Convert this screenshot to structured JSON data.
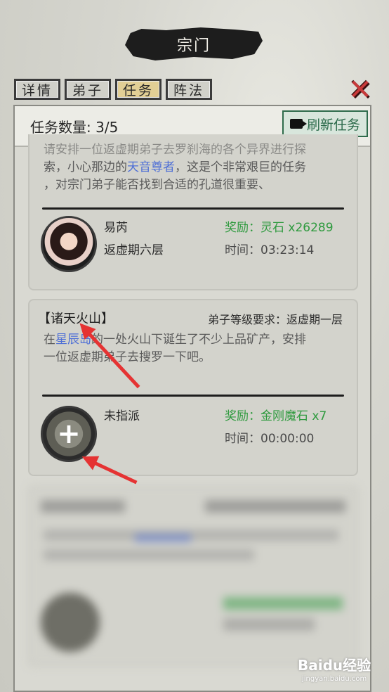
{
  "window": {
    "title": "宗门"
  },
  "tabs": [
    {
      "label": "详情"
    },
    {
      "label": "弟子"
    },
    {
      "label": "任务",
      "active": true
    },
    {
      "label": "阵法"
    }
  ],
  "close_icon": "close-x-icon",
  "header": {
    "task_count_label": "任务数量:",
    "task_count_value": "3/5",
    "refresh_label": "刷新任务",
    "refresh_icon": "video-camera-icon"
  },
  "task1": {
    "desc_line1": "请安排一位返虚期弟子去罗刹海的各个异界进行探",
    "desc_line2_pre": "索，小心那边的",
    "desc_line2_hl": "天音尊者",
    "desc_line2_post": "，这是个非常艰巨的任务",
    "desc_line3": "，对宗门弟子能否找到合适的孔道很重要、",
    "disciple_name": "易芮",
    "disciple_rank": "返虚期六层",
    "reward": "奖励：灵石 x26289",
    "time": "时间：03:23:14"
  },
  "task2": {
    "title": "【诸天火山】",
    "requirement": "弟子等级要求：返虚期一层",
    "desc_line1_pre": "在",
    "desc_line1_hl": "星辰岛",
    "desc_line1_post": "的一处火山下诞生了不少上品矿产，安排",
    "desc_line2": "一位返虚期弟子去搜罗一下吧。",
    "assign_status": "未指派",
    "reward": "奖励：金刚魔石 x7",
    "time": "时间：00:00:00",
    "add_icon": "plus-icon"
  },
  "watermark": {
    "text": "Baidu经验",
    "sub": "jingyan.baidu.com"
  },
  "colors": {
    "reward_green": "#2e9a3e",
    "highlight_blue": "#4d6ed6",
    "close_red": "#c83a3a",
    "arrow_red": "#e53333"
  }
}
